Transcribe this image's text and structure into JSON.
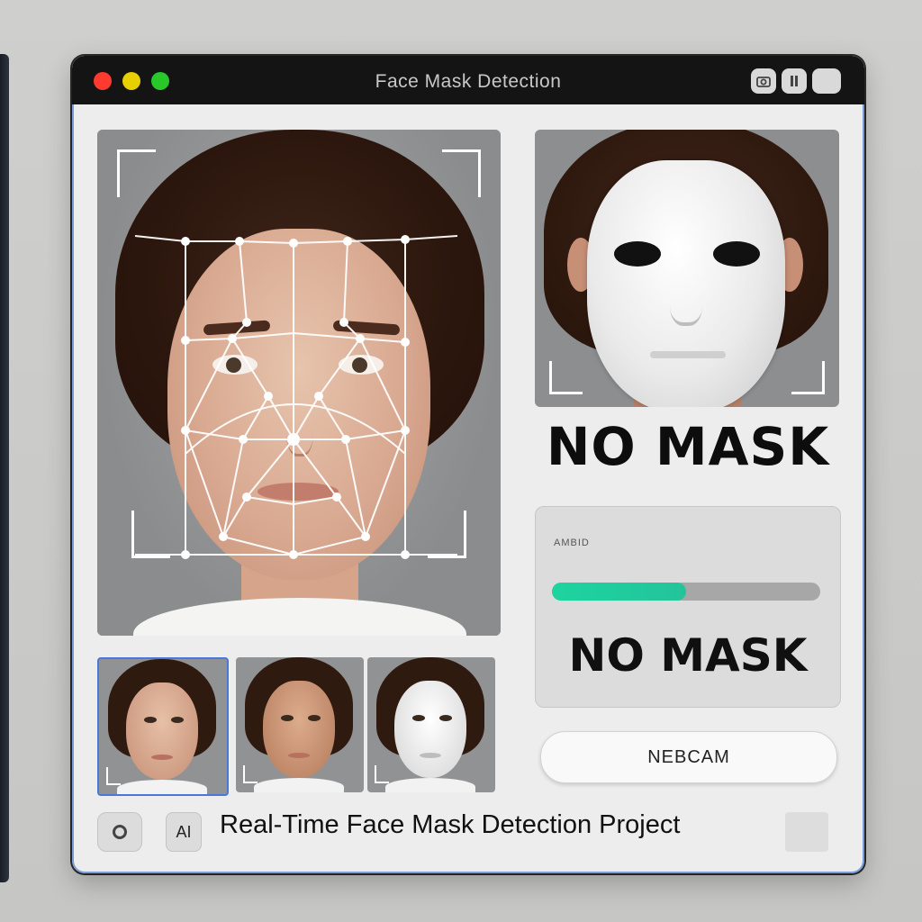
{
  "window": {
    "title": "Face Mask Detection",
    "controls": [
      "camera-icon",
      "pause-icon",
      "toggle-icon"
    ]
  },
  "main_view": {
    "mesh_label": ""
  },
  "preview": {
    "status_large": "NO MASK"
  },
  "result_panel": {
    "label": "AMBID",
    "confidence_fraction": 0.5,
    "status": "NO MASK",
    "accent_color": "#1dd49f"
  },
  "webcam_button": {
    "label": "NEBCAM"
  },
  "thumbnails": [
    {
      "name": "thumbnail-1",
      "selected": true
    },
    {
      "name": "thumbnail-2",
      "selected": false
    },
    {
      "name": "thumbnail-3-masked",
      "selected": false
    }
  ],
  "footer": {
    "ai_badge": "AI",
    "title": "Real-Time Face Mask Detection Project"
  }
}
